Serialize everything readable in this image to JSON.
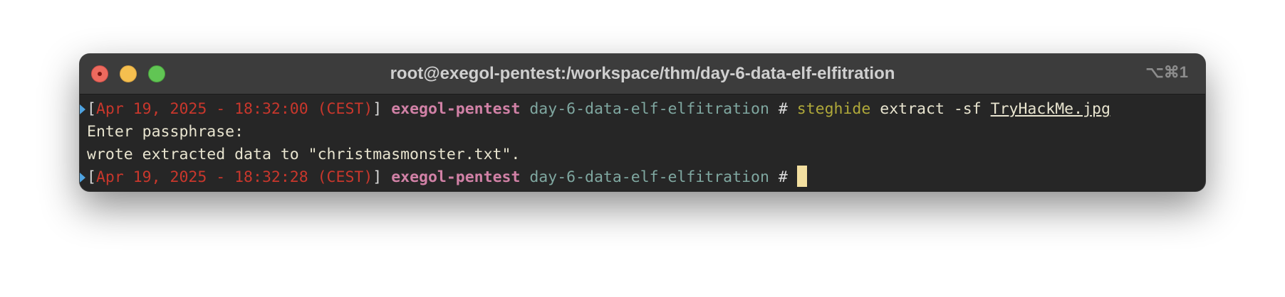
{
  "window": {
    "title": "root@exegol-pentest:/workspace/thm/day-6-data-elf-elfitration",
    "shortcut": "⌥⌘1"
  },
  "terminal": {
    "lines": [
      {
        "timestamp": "Apr 19, 2025 - 18:32:00 (CEST)",
        "host": "exegol-pentest",
        "directory": "day-6-data-elf-elfitration",
        "prompt_symbol": "#",
        "command": "steghide",
        "args": "extract -sf",
        "file_arg": "TryHackMe.jpg"
      },
      {
        "output": "Enter passphrase:"
      },
      {
        "output": "wrote extracted data to \"christmasmonster.txt\"."
      },
      {
        "timestamp": "Apr 19, 2025 - 18:32:28 (CEST)",
        "host": "exegol-pentest",
        "directory": "day-6-data-elf-elfitration",
        "prompt_symbol": "#"
      }
    ]
  },
  "colors": {
    "background": "#262626",
    "titlebar": "#3c3c3c",
    "timestamp": "#c9372c",
    "host": "#d181a6",
    "directory": "#7fa7a0",
    "command": "#b0a93a",
    "cursor": "#f3dfa0"
  }
}
